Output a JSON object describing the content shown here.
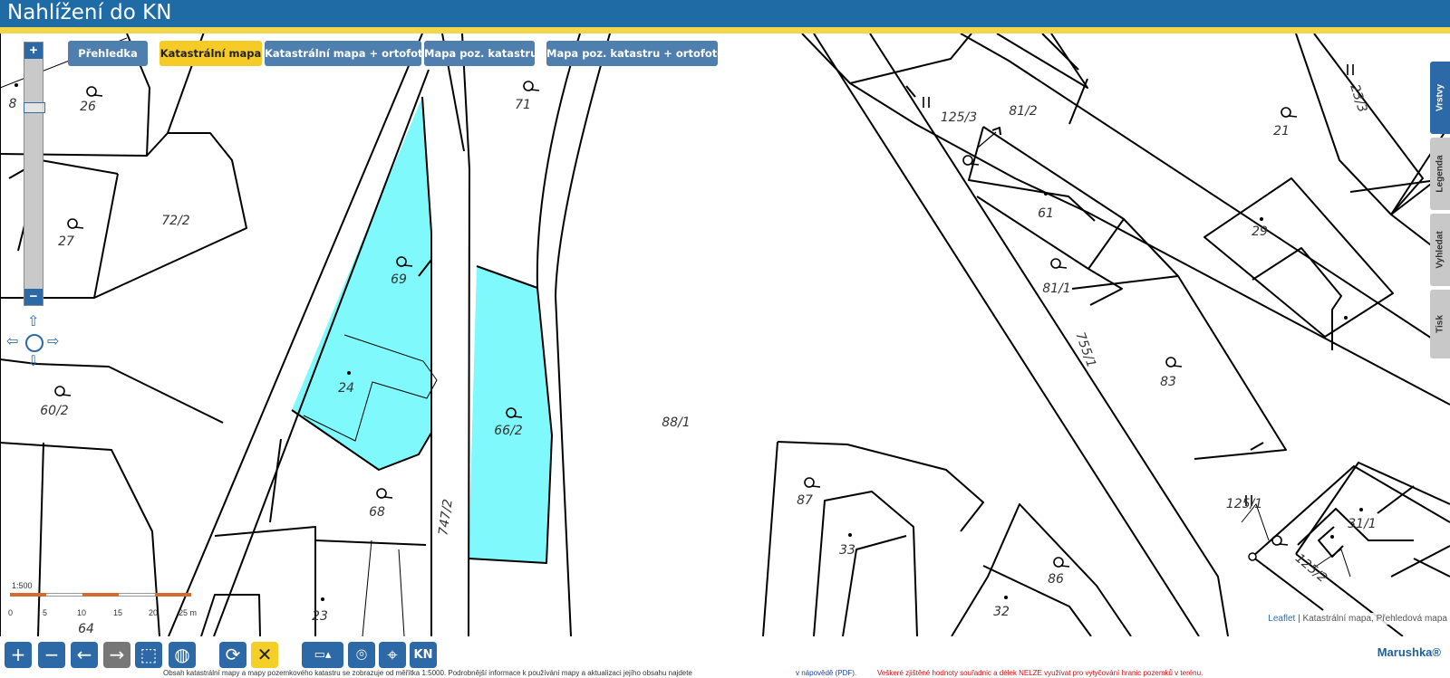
{
  "app": {
    "title": "Nahlížení do KN"
  },
  "map_tabs": [
    {
      "label": "Přehledka"
    },
    {
      "label": "Katastrální mapa"
    },
    {
      "label": "Katastrální mapa + ortofoto"
    },
    {
      "label": "Mapa poz. katastru"
    },
    {
      "label": "Mapa poz. katastru + ortofoto"
    }
  ],
  "side_tabs": [
    {
      "label": "Vrstvy"
    },
    {
      "label": "Legenda"
    },
    {
      "label": "Vyhledat"
    },
    {
      "label": "Tisk"
    }
  ],
  "zoom": {
    "plus": "+",
    "minus": "−",
    "level_fraction": 0.25
  },
  "parcels": [
    {
      "label": "8"
    },
    {
      "label": "26"
    },
    {
      "label": "27"
    },
    {
      "label": "72/2"
    },
    {
      "label": "69"
    },
    {
      "label": "24"
    },
    {
      "label": "71"
    },
    {
      "label": "66/2"
    },
    {
      "label": "88/1"
    },
    {
      "label": "60/2"
    },
    {
      "label": "68"
    },
    {
      "label": "747/2"
    },
    {
      "label": "23"
    },
    {
      "label": "64"
    },
    {
      "label": "125/3"
    },
    {
      "label": "81/2"
    },
    {
      "label": "61"
    },
    {
      "label": "81/1"
    },
    {
      "label": "755/1"
    },
    {
      "label": "83"
    },
    {
      "label": "21"
    },
    {
      "label": "23/3"
    },
    {
      "label": "29"
    },
    {
      "label": "87"
    },
    {
      "label": "33"
    },
    {
      "label": "86"
    },
    {
      "label": "32"
    },
    {
      "label": "125/1"
    },
    {
      "label": "31/1"
    },
    {
      "label": "125/2"
    }
  ],
  "scale": {
    "ratio": "1:500",
    "ticks": [
      "0",
      "5",
      "10",
      "15",
      "20",
      "25 m"
    ],
    "colors": [
      "#d26b2e",
      "#ffffff",
      "#d26b2e",
      "#ffffff",
      "#d26b2e"
    ]
  },
  "attribution": {
    "leaflet": "Leaflet",
    "rest": " | Katastrální mapa, Přehledová mapa"
  },
  "toolbar": {
    "zoom_in": "+",
    "zoom_out": "−",
    "back": "←",
    "forward": "→",
    "extent": "⬚",
    "world": "◍",
    "refresh": "⟳",
    "clear": "✕",
    "measure": "▭▴",
    "place": "⌾",
    "locate": "⌖",
    "kn": "KN"
  },
  "brand": "Marushka®",
  "footer": {
    "left": "Obsah katastrální mapy a mapy pozemkového katastru se zobrazuje od měřítka 1:5000. Podrobnější informace k používání mapy a aktualizaci jejího obsahu najdete",
    "link": "v nápovědě (PDF).",
    "warning": "Veškeré zjištěné hodnoty souřadnic a délek NELZE využívat pro vytyčování hranic pozemků v terénu."
  },
  "colors": {
    "header": "#1e6ba6",
    "header_stripe": "#f2d64b",
    "tab": "#4f7fae",
    "tab_active": "#f6cb27",
    "highlight_fill": "#7ff9fb",
    "tool_button": "#2d69a6"
  }
}
